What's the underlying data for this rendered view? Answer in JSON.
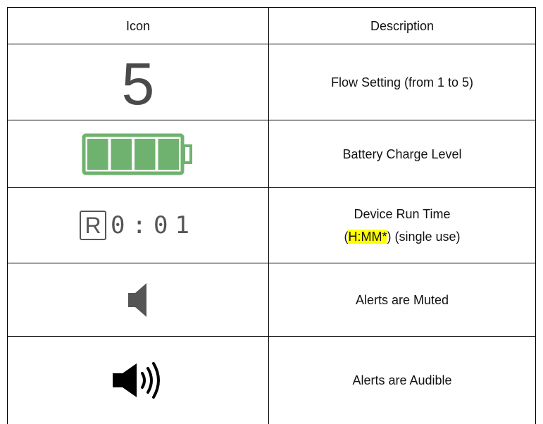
{
  "header": {
    "icon": "Icon",
    "description": "Description"
  },
  "rows": [
    {
      "icon_name": "flow-setting-5-icon",
      "icon_text": "5",
      "description": "Flow Setting (from 1 to 5)"
    },
    {
      "icon_name": "battery-full-icon",
      "battery_level": 1.0,
      "description": "Battery Charge Level"
    },
    {
      "icon_name": "run-time-icon",
      "icon_label": "R",
      "icon_digits": "0:01",
      "description_line1": "Device Run Time",
      "description_line2_pre": "(",
      "description_line2_highlight": "H:MM*",
      "description_line2_post": ") (single use)"
    },
    {
      "icon_name": "speaker-muted-icon",
      "description": "Alerts are Muted"
    },
    {
      "icon_name": "speaker-audible-icon",
      "description": "Alerts are Audible"
    }
  ],
  "colors": {
    "battery": "#6fb26f",
    "highlight": "#ffff00",
    "icon_gray": "#555555"
  }
}
